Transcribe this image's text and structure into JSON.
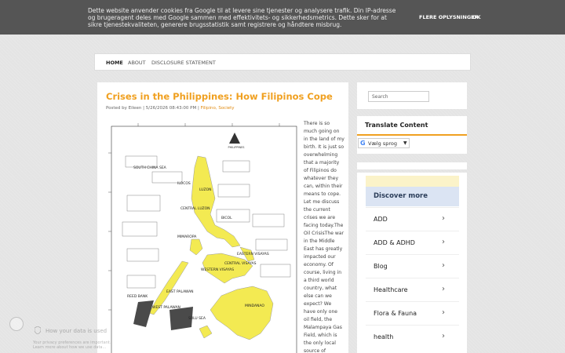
{
  "cookie_bar": {
    "text": "Dette website anvender cookies fra Google til at levere sine tjenester og analysere trafik. Din IP-adresse og brugeragent deles med Google sammen med effektivitets- og sikkerhedsmetrics. Dette sker for at sikre tjenestekvaliteten, generere brugsstatistik samt registrere og håndtere misbrug.",
    "more_label": "FLERE OPLYSNINGER",
    "ok_label": "OK"
  },
  "nav": {
    "items": [
      {
        "label": "HOME"
      },
      {
        "label": "ABOUT"
      },
      {
        "label": "DISCLOSURE STATEMENT"
      }
    ]
  },
  "post": {
    "title": "Crises in the Philippines: How Filipinos Cope",
    "meta_prefix": "Posted by Eileen",
    "meta_date": "5/26/2026 08:43:00 PM",
    "tag_1": "Filipino",
    "tag_2": "Society",
    "body": "There is so much going on in the land of my birth. It is just so overwhelming that a majority of Filipinos do whatever they can, within their means to cope. Let me discuss the current crises we are facing today.The Oil CrisisThe war in the Middle East has greatly impacted our economy. Of course, living in a third world country, what else can we expect?  We have only one oil field, the Malampaya Gas Field, which is the only local source of"
  },
  "map": {
    "title": "PHILIPPINES",
    "labels": {
      "south_china_sea": "SOUTH CHINA SEA",
      "luzon": "LUZON",
      "ilocos": "ILOCOS",
      "central_luzon": "CENTRAL LUZON",
      "bicol": "BICOL",
      "mimaropa": "MIMAROPA",
      "western_visayas": "WESTERN VISAYAS",
      "central_visayas": "CENTRAL VISAYAS",
      "eastern_visayas": "EASTERN VISAYAS",
      "sulu_sea": "SULU SEA",
      "mindanao": "MINDANAO",
      "reed_bank": "REED BANK",
      "east_palawan": "EAST PALAWAN",
      "west_palawan": "WEST PALAWAN"
    }
  },
  "sidebar": {
    "search_placeholder": "Search",
    "translate_title": "Translate Content",
    "lang_label": "Vælg sprog",
    "lang_arrow": "▼",
    "discover_title": "Discover more",
    "discover_items": [
      {
        "label": "ADD"
      },
      {
        "label": "ADD & ADHD"
      },
      {
        "label": "Blog"
      },
      {
        "label": "Healthcare"
      },
      {
        "label": "Flora & Fauna"
      },
      {
        "label": "health"
      }
    ]
  },
  "privacy_widget": {
    "title": "How your data is used",
    "sub": "Your privacy preferences are important. Learn more about how we use data..."
  },
  "colors": {
    "accent": "#f0a020",
    "cookie_bg": "#555555",
    "discover_head": "#dbe4f3",
    "map_yellow": "#f3ea52"
  }
}
